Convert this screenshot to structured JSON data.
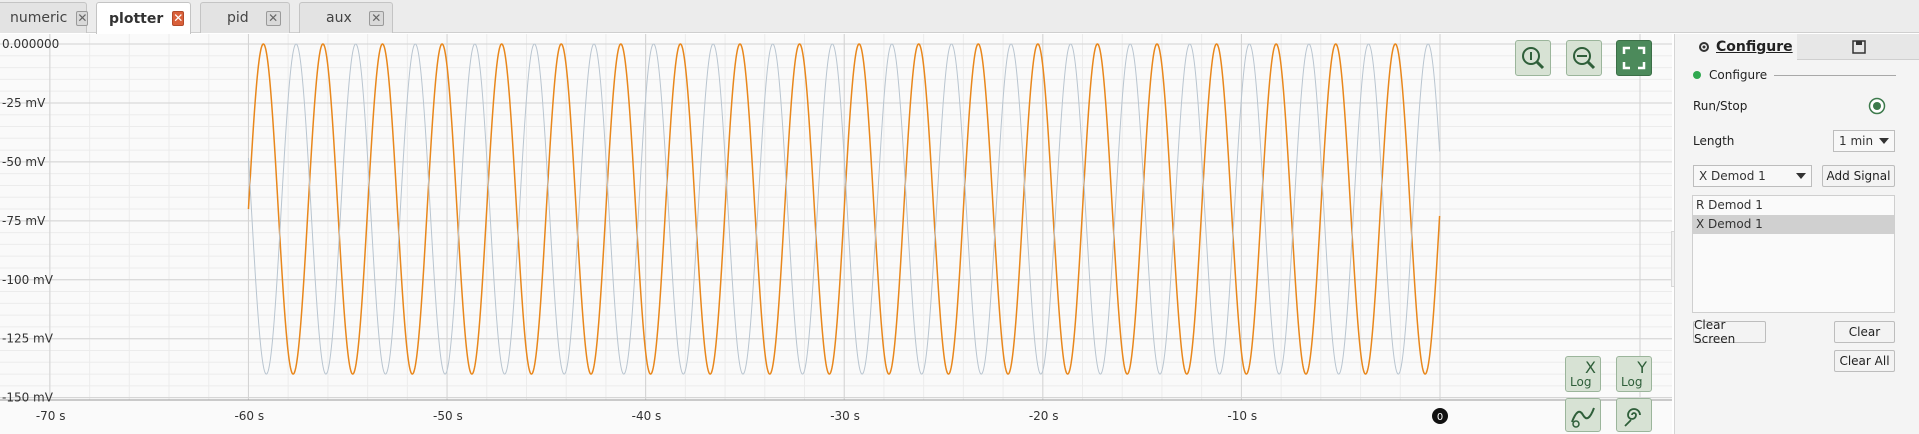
{
  "tabs": [
    {
      "label": "numeric",
      "active": false
    },
    {
      "label": "plotter",
      "active": true
    },
    {
      "label": "pid",
      "active": false
    },
    {
      "label": "aux",
      "active": false
    }
  ],
  "plot": {
    "y_ticks": [
      "0.000000",
      "-25 mV",
      "-50 mV",
      "-75 mV",
      "-100 mV",
      "-125 mV",
      "-150 mV"
    ],
    "x_ticks": [
      "-70 s",
      "-60 s",
      "-50 s",
      "-40 s",
      "-30 s",
      "-20 s",
      "-10 s"
    ],
    "now_marker": "0",
    "controls": {
      "zoom_info": "zoom-info-icon",
      "zoom_fit": "zoom-fit-horizontal-icon",
      "full_scale": "full-scale-icon",
      "x_log": {
        "axis": "X",
        "label": "Log"
      },
      "y_log": {
        "axis": "Y",
        "label": "Log"
      }
    }
  },
  "chart_data": {
    "type": "line",
    "xlabel": "",
    "ylabel": "",
    "xlim": [
      -71,
      0
    ],
    "ylim": [
      -151,
      0
    ],
    "series": [
      {
        "color": "#e8871c",
        "shape": "sine",
        "offset": -70,
        "amplitude": 70,
        "period_s": 3.0,
        "x_range": [
          -60,
          0
        ]
      },
      {
        "color": "#b9c5d0",
        "shape": "sine",
        "offset": -70,
        "amplitude": 70,
        "period_s": 3.0,
        "x_range": [
          -60,
          0
        ]
      }
    ],
    "grid": true
  },
  "panel": {
    "tab_configure": "Configure",
    "section": "Configure",
    "run_stop_label": "Run/Stop",
    "length_label": "Length",
    "length_value": "1 min",
    "signal_select": "X Demod 1",
    "add_signal": "Add Signal",
    "signals": [
      "R Demod 1",
      "X Demod 1"
    ],
    "selected_signal": "X Demod 1",
    "clear_screen": "Clear Screen",
    "clear": "Clear",
    "clear_all": "Clear All",
    "accent_green": "#2fa84f"
  }
}
